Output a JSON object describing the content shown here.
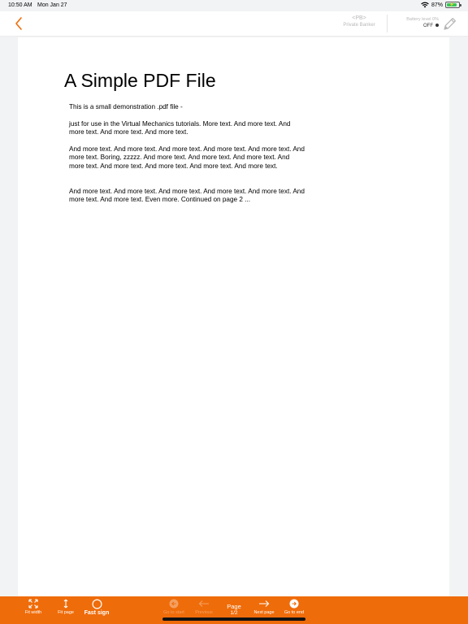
{
  "status_bar": {
    "time": "10:50 AM",
    "date": "Mon Jan 27",
    "battery_percent": "87%",
    "battery_level": 0.87,
    "wifi_icon": "wifi-icon",
    "charging_icon": "bolt-icon"
  },
  "nav": {
    "back_icon": "chevron-left-icon",
    "pb_title": "<PB>",
    "pb_subtitle": "Private Banker",
    "battery_level_label": "Battery level 0%",
    "battery_state": "OFF",
    "pen_icon": "pen-icon",
    "accent_color": "#ef6c0a"
  },
  "document": {
    "title": "A Simple PDF File",
    "paragraphs": [
      "This is a small demonstration .pdf file -",
      "just for use in the Virtual Mechanics tutorials. More text. And more text. And more text. And more text. And more text.",
      "And more text. And more text. And more text. And more text. And more text. And more text. Boring, zzzzz. And more text. And more text. And more text. And more text. And more text. And more text. And more text. And more text.",
      "And more text. And more text. And more text. And more text. And more text. And more text. And more text. Even more. Continued on page 2 ..."
    ]
  },
  "toolbar": {
    "background_color": "#ef6c0a",
    "fit_width_label": "Fit width",
    "fit_page_label": "Fit page",
    "fast_sign_label": "Fast sign",
    "go_start_label": "Go to start",
    "previous_label": "Previous",
    "page_label": "Page",
    "page_number": "1/2",
    "next_label": "Next page",
    "go_end_label": "Go to end",
    "icons": {
      "fit_width": "expand-arrows-icon",
      "fit_page": "vertical-arrows-icon",
      "fast_sign": "circle-icon",
      "go_start": "circle-arrow-left-icon",
      "previous": "arrow-left-icon",
      "next": "arrow-right-icon",
      "go_end": "circle-arrow-right-icon"
    }
  }
}
